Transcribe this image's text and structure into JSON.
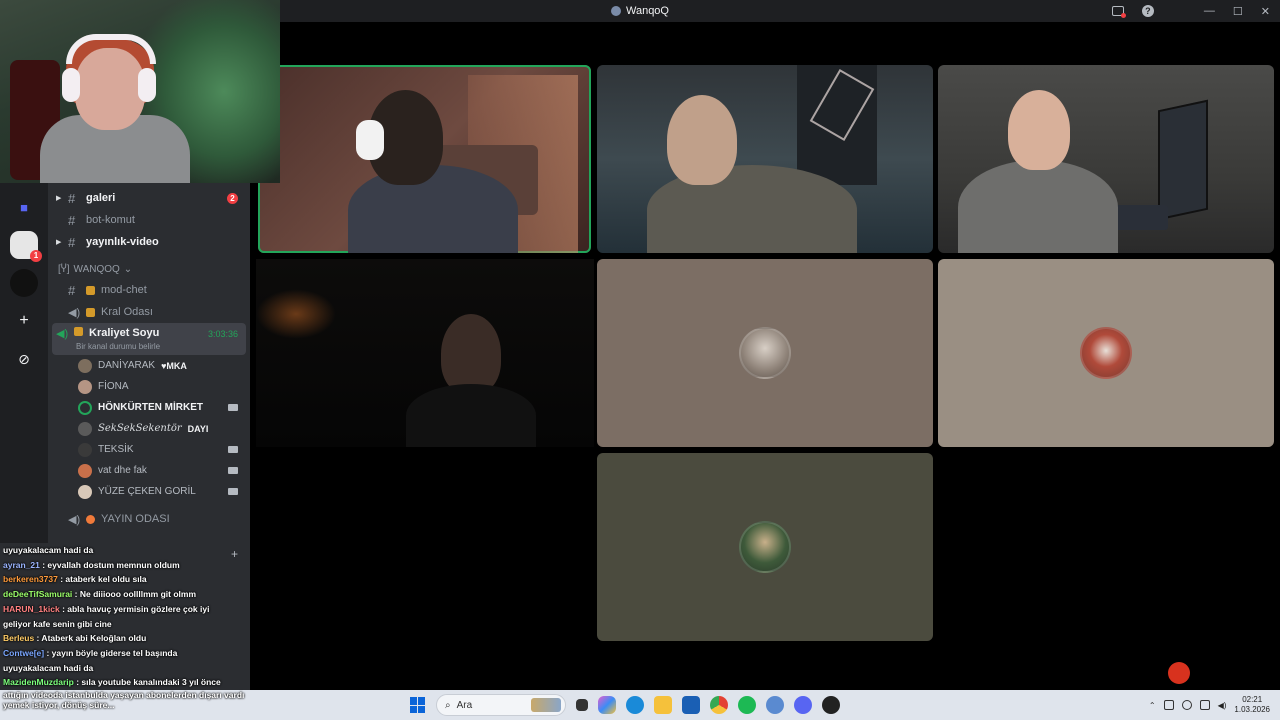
{
  "window": {
    "title": "WanqoQ"
  },
  "servers": {
    "items": [
      {
        "name": "direct-messages",
        "icon": "dm-icon"
      },
      {
        "name": "server-active",
        "badge": "1"
      },
      {
        "name": "server-dark"
      },
      {
        "name": "add-server",
        "icon": "plus-icon",
        "glyph": "+"
      },
      {
        "name": "explore",
        "icon": "compass-icon",
        "glyph": "⊘"
      }
    ]
  },
  "channels": {
    "text": [
      {
        "name": "galeri",
        "count": "2"
      },
      {
        "name": "bot-komut"
      },
      {
        "name": "yayınlık-video"
      }
    ],
    "category": "WANQOQ",
    "category_prefix": "[Ⴤ]",
    "mod": {
      "name": "mod-chet"
    },
    "voice_kral": {
      "name": "Kral Odası"
    },
    "voice_active": {
      "name": "Kraliyet Soyu",
      "time": "3:03:36",
      "status": "Bir kanal durumu belirle"
    },
    "users": [
      {
        "name": "DANİYARAK",
        "tag": "♥MKA",
        "bold": false
      },
      {
        "name": "FİONA",
        "bold": false
      },
      {
        "name": "HÖNKÜRTEN MİRKET",
        "bold": true,
        "cam": true
      },
      {
        "name": "SekSekSekentör",
        "tag": "DAYI",
        "bold": false,
        "fancy": true
      },
      {
        "name": "TEKSİK",
        "bold": false,
        "cam": true
      },
      {
        "name": "vat dhe fak",
        "bold": false,
        "cam": true
      },
      {
        "name": "YÜZE ÇEKEN GORİL",
        "bold": false,
        "cam": true
      }
    ],
    "voice_yayin": {
      "name": "YAYIN ODASI"
    }
  },
  "chat": {
    "messages": [
      {
        "user": "",
        "text": "uyuyakalacam hadi da",
        "color": "#ffffff"
      },
      {
        "user": "ayran_21",
        "text": " : eyvallah dostum memnun oldum",
        "color": "#9ab4ff"
      },
      {
        "user": "berkeren3737",
        "text": " : ataberk kel oldu sıla",
        "color": "#ff9b3b"
      },
      {
        "user": "deDeeTifSamurai",
        "text": " : Ne diiiooo oollllmm git olmm",
        "color": "#9cff6a"
      },
      {
        "user": "HARUN_1kick",
        "text": " : abla havuç yermisin gözlere çok iyi",
        "color": "#ff8080"
      },
      {
        "user": "",
        "text": "geliyor kafe senin gibi cine",
        "color": "#ffffff"
      },
      {
        "user": "Berleus",
        "text": " : Ataberk abi Keloğlan oldu",
        "color": "#ffcc66"
      },
      {
        "user": "Contwe[e]",
        "text": " : yayın böyle giderse tel başında",
        "color": "#7aa6ff"
      },
      {
        "user": "",
        "text": "uyuyakalacam hadi da",
        "color": "#ffffff"
      },
      {
        "user": "MazidenMuzdarip",
        "text": " : sıla youtube kanalındaki 3 yıl önce",
        "color": "#7cff7c"
      }
    ],
    "ticker_lines": [
      "attığın videoda istanbulda yaşayan abonelerden dışarı vardı",
      "yemek istiyor, dönüş süre..."
    ]
  },
  "taskbar": {
    "search_placeholder": "Ara",
    "time": "02:21",
    "date": "1.03.2026"
  },
  "colors": {
    "speaking": "#23a55a",
    "discord_bg": "#2b2d31",
    "accent": "#5865f2"
  }
}
